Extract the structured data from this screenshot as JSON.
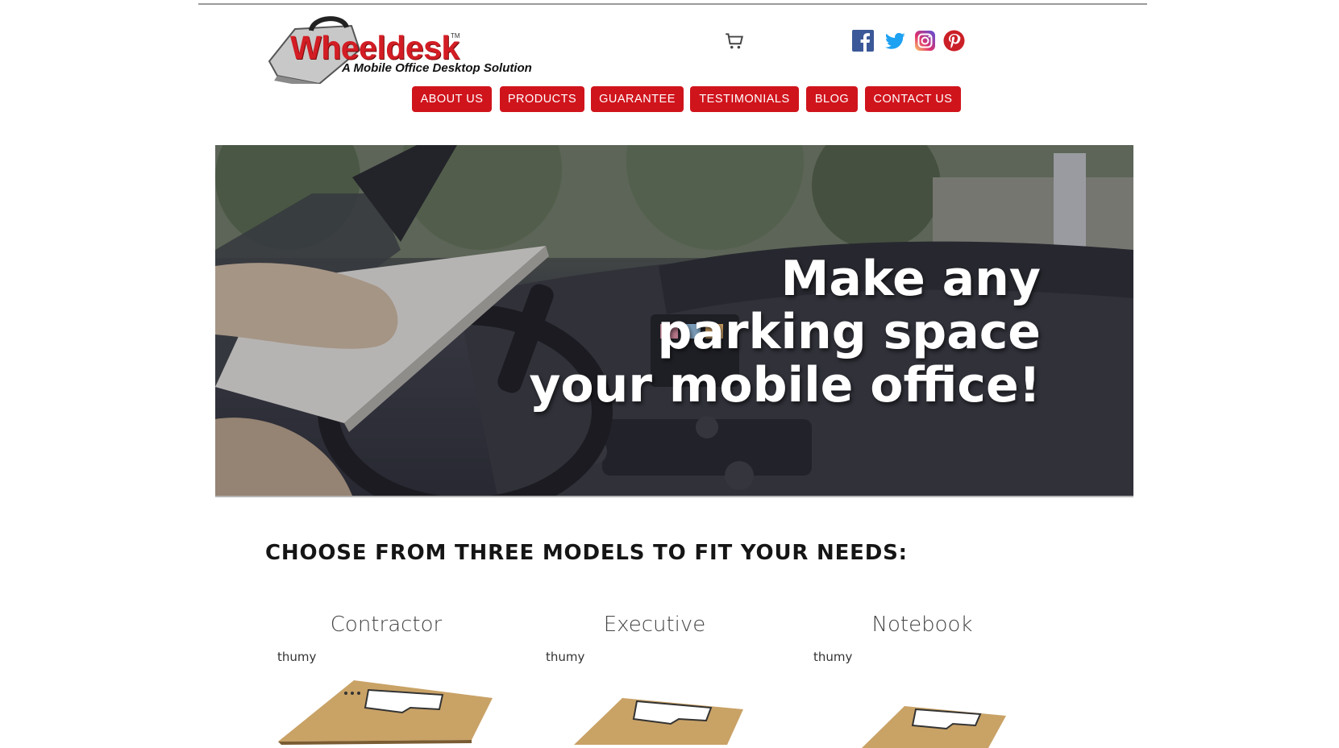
{
  "header": {
    "logo_word": "Wheeldesk",
    "logo_tm": "TM",
    "logo_tagline": "A Mobile Office Desktop Solution",
    "cart_icon": "shopping-cart-icon",
    "social": [
      "facebook-icon",
      "twitter-icon",
      "instagram-icon",
      "pinterest-icon"
    ]
  },
  "nav": {
    "items": [
      {
        "label": "ABOUT US"
      },
      {
        "label": "PRODUCTS"
      },
      {
        "label": "GUARANTEE"
      },
      {
        "label": "TESTIMONIALS"
      },
      {
        "label": "BLOG"
      },
      {
        "label": "CONTACT US"
      }
    ]
  },
  "hero": {
    "line1": "Make any",
    "line2": "parking space",
    "line3": "your mobile office!"
  },
  "section": {
    "title": "CHOOSE FROM THREE MODELS TO FIT YOUR NEEDS:"
  },
  "models": [
    {
      "name": "Contractor",
      "thumb_label": "thumy"
    },
    {
      "name": "Executive",
      "thumb_label": "thumy"
    },
    {
      "name": "Notebook",
      "thumb_label": "thumy"
    }
  ],
  "colors": {
    "brand_red": "#d0141c",
    "wood": "#c9a266"
  }
}
